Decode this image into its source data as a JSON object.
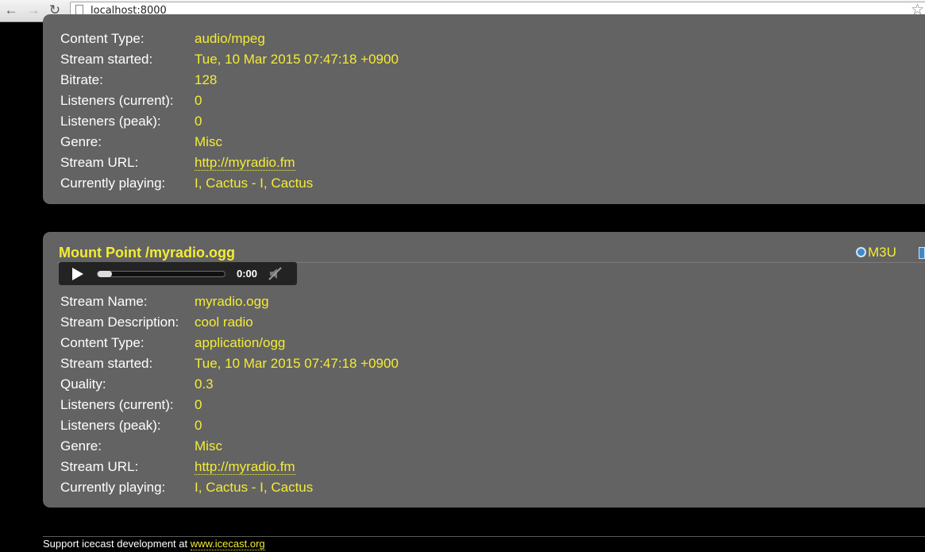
{
  "browser": {
    "url": "localhost:8000"
  },
  "mount1": {
    "rows": [
      {
        "label": "Content Type:",
        "value": "audio/mpeg"
      },
      {
        "label": "Stream started:",
        "value": "Tue, 10 Mar 2015 07:47:18 +0900"
      },
      {
        "label": "Bitrate:",
        "value": "128"
      },
      {
        "label": "Listeners (current):",
        "value": "0"
      },
      {
        "label": "Listeners (peak):",
        "value": "0"
      },
      {
        "label": "Genre:",
        "value": "Misc"
      },
      {
        "label": "Stream URL:",
        "value": "http://myradio.fm"
      },
      {
        "label": "Currently playing:",
        "value": "I, Cactus - I, Cactus"
      }
    ]
  },
  "mount2": {
    "title": "Mount Point /myradio.ogg",
    "m3u_label": "M3U",
    "player": {
      "time": "0:00",
      "progress": 0
    },
    "rows": [
      {
        "label": "Stream Name:",
        "value": "myradio.ogg"
      },
      {
        "label": "Stream Description:",
        "value": "cool radio"
      },
      {
        "label": "Content Type:",
        "value": "application/ogg"
      },
      {
        "label": "Stream started:",
        "value": "Tue, 10 Mar 2015 07:47:18 +0900"
      },
      {
        "label": "Quality:",
        "value": "0.3"
      },
      {
        "label": "Listeners (current):",
        "value": "0"
      },
      {
        "label": "Listeners (peak):",
        "value": "0"
      },
      {
        "label": "Genre:",
        "value": "Misc"
      },
      {
        "label": "Stream URL:",
        "value": "http://myradio.fm"
      },
      {
        "label": "Currently playing:",
        "value": "I, Cactus - I, Cactus"
      }
    ]
  },
  "footer": {
    "text": "Support icecast development at ",
    "link": "www.icecast.org"
  }
}
